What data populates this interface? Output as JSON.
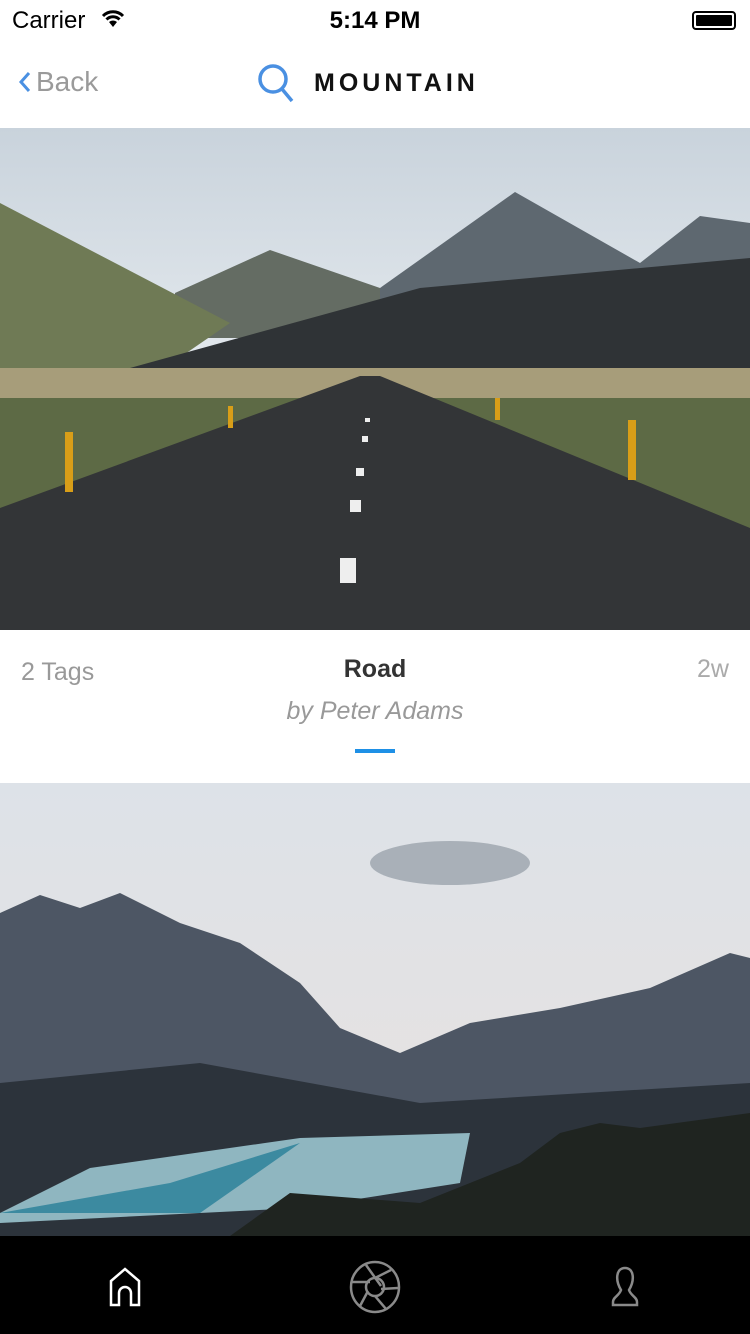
{
  "status": {
    "carrier": "Carrier",
    "time": "5:14 PM"
  },
  "nav": {
    "back_label": "Back",
    "title": "MOUNTAIN"
  },
  "posts": [
    {
      "tags": "2 Tags",
      "title": "Road",
      "author": "by Peter Adams",
      "age": "2w"
    }
  ],
  "colors": {
    "accent": "#1e90e6",
    "search": "#4a90e2"
  },
  "tabbar": {
    "items": [
      "home-icon",
      "camera-aperture-icon",
      "profile-icon"
    ]
  }
}
